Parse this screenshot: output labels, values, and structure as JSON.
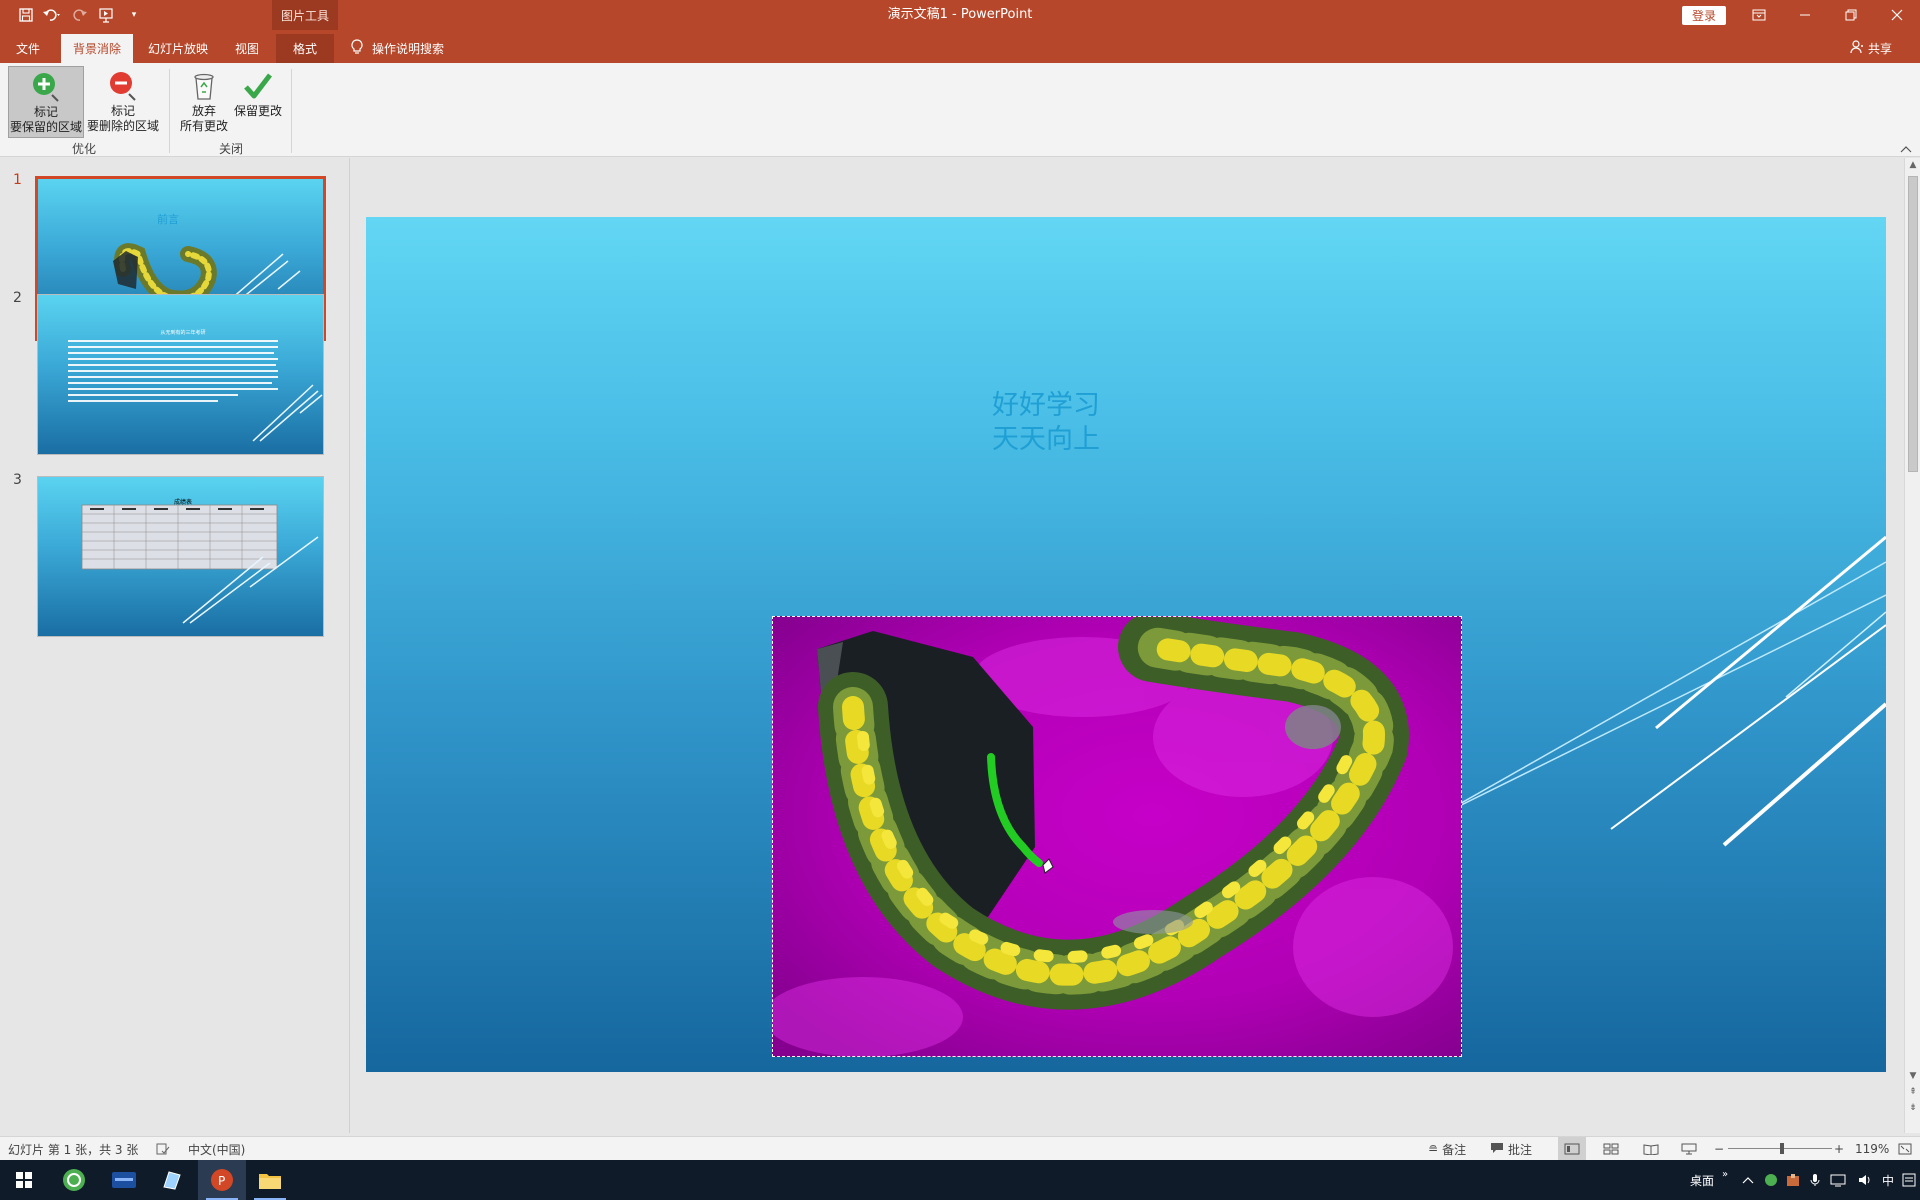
{
  "window": {
    "title": "演示文稿1  -  PowerPoint",
    "contextual_tab_group": "图片工具",
    "login_label": "登录"
  },
  "tabs": {
    "file": "文件",
    "background_removal": "背景消除",
    "slideshow": "幻灯片放映",
    "view": "视图",
    "format": "格式",
    "tell_me": "操作说明搜索",
    "share": "共享"
  },
  "ribbon": {
    "mark_keep_line1": "标记",
    "mark_keep_line2": "要保留的区域",
    "mark_remove_line1": "标记",
    "mark_remove_line2": "要删除的区域",
    "discard_line1": "放弃",
    "discard_line2": "所有更改",
    "keep_changes": "保留更改",
    "group_refine": "优化",
    "group_close": "关闭"
  },
  "thumbnails": [
    {
      "number": "1",
      "title": "前言"
    },
    {
      "number": "2",
      "heading": "从无到有的三年考研"
    },
    {
      "number": "3",
      "heading": "成绩表"
    }
  ],
  "slide": {
    "title_line1": "好好学习",
    "title_line2": "天天向上"
  },
  "status": {
    "slide_info": "幻灯片 第 1 张，共 3 张",
    "language": "中文(中国)",
    "notes": "备注",
    "comments": "批注",
    "zoom": "119%"
  },
  "taskbar": {
    "desktop": "桌面",
    "ime": "中"
  },
  "colors": {
    "accent": "#b7472a",
    "remove_area": "#cc00cc",
    "keep_stroke": "#22cc22"
  }
}
